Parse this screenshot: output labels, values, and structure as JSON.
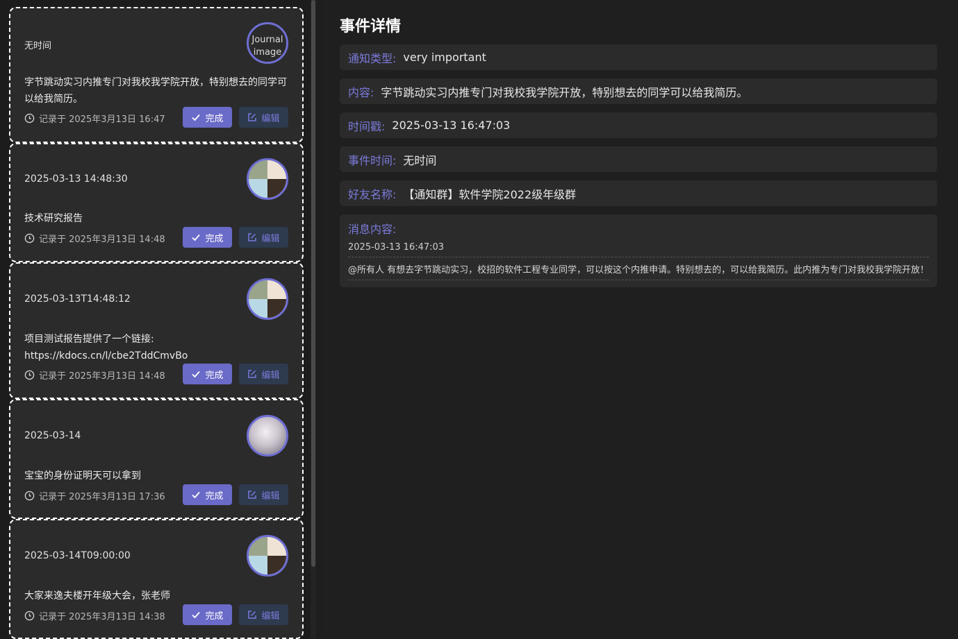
{
  "list": {
    "done_label": "完成",
    "edit_label": "编辑",
    "items": [
      {
        "date": "无时间",
        "avatar_alt": "Journal image",
        "content": "字节跳动实习内推专门对我校我学院开放，特别想去的同学可以给我简历。",
        "recorded": "记录于 2025年3月13日 16:47"
      },
      {
        "date": "2025-03-13 14:48:30",
        "content": "技术研究报告",
        "recorded": "记录于 2025年3月13日 14:48"
      },
      {
        "date": "2025-03-13T14:48:12",
        "content": "项目测试报告提供了一个链接: https://kdocs.cn/l/cbe2TddCmvBo",
        "recorded": "记录于 2025年3月13日 14:48"
      },
      {
        "date": "2025-03-14",
        "content": "宝宝的身份证明天可以拿到",
        "recorded": "记录于 2025年3月13日 17:36"
      },
      {
        "date": "2025-03-14T09:00:00",
        "content": "大家来逸夫楼开年级大会，张老师",
        "recorded": "记录于 2025年3月13日 14:38"
      }
    ]
  },
  "detail": {
    "title": "事件详情",
    "fields": [
      {
        "key": "通知类型:",
        "value": "very important"
      },
      {
        "key": "内容:",
        "value": "字节跳动实习内推专门对我校我学院开放，特别想去的同学可以给我简历。"
      },
      {
        "key": "时间戳:",
        "value": "2025-03-13 16:47:03"
      },
      {
        "key": "事件时间:",
        "value": "无时间"
      },
      {
        "key": "好友名称:",
        "value": "【通知群】软件学院2022级年级群"
      }
    ],
    "message": {
      "key": "消息内容:",
      "timestamp": "2025-03-13 16:47:03",
      "text": "@所有人 有想去字节跳动实习，校招的软件工程专业同学，可以按这个内推申请。特别想去的，可以给我简历。此内推为专门对我校我学院开放！"
    }
  },
  "colors": {
    "accent": "#6a6ac8",
    "label": "#7b7bdb",
    "card_bg": "#2b2b2c",
    "page_bg": "#1e1e1f"
  }
}
